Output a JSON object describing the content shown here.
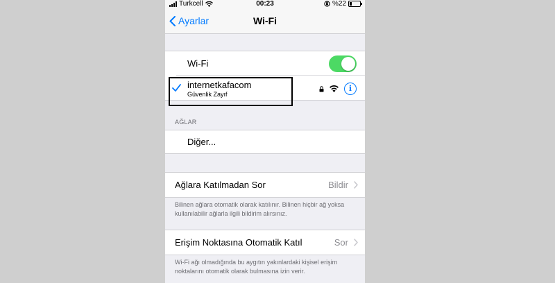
{
  "statusbar": {
    "carrier": "Turkcell",
    "time": "00:23",
    "battery": "%22",
    "battery_level": 0.22
  },
  "nav": {
    "back_label": "Ayarlar",
    "title": "Wi-Fi"
  },
  "wifi_toggle": {
    "label": "Wi-Fi",
    "on": true
  },
  "connected_network": {
    "name": "internetkafacom",
    "subtitle": "Güvenlik Zayıf",
    "info_glyph": "i"
  },
  "networks_section": {
    "header": "AĞLAR",
    "other_label": "Diğer..."
  },
  "ask_join": {
    "label": "Ağlara Katılmadan Sor",
    "value": "Bildir",
    "footer": "Bilinen ağlara otomatik olarak katılınır. Bilinen hiçbir ağ yoksa kullanılabilir ağlarla ilgili bildirim alırsınız."
  },
  "auto_hotspot": {
    "label": "Erişim Noktasına Otomatik Katıl",
    "value": "Sor",
    "footer": "Wi-Fi ağı olmadığında bu aygıtın yakınlardaki kişisel erişim noktalarını otomatik olarak bulmasına izin verir."
  },
  "colors": {
    "accent": "#007aff",
    "toggle_on": "#4cd964",
    "background": "#efeff4"
  }
}
